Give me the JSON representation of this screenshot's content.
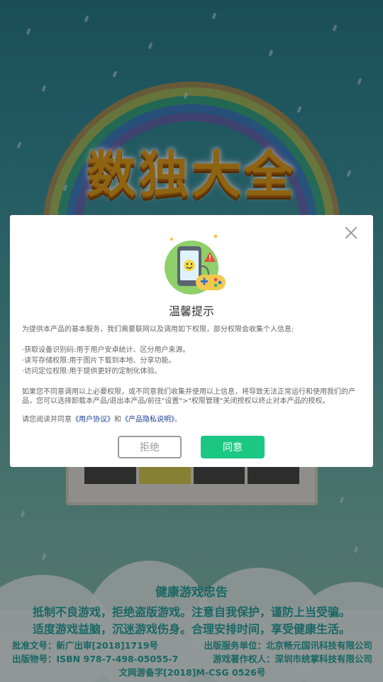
{
  "app": {
    "title": "数独大全"
  },
  "dialog": {
    "title": "温馨提示",
    "intro": "为提供本产品的基本服务，我们需要联网以及调用如下权限，部分权限会收集个人信息:",
    "permissions": [
      "·获取设备识别码:用于用户安卓统计、区分用户来源。",
      "·读写存储权限:用于图片下载到本地、分享功能。",
      "·访问定位权限:用于提供更好的定制化体验。"
    ],
    "disclaimer": "如果您不同意调用以上必要权限，或不同意我们收集并使用以上信息，将导致无法正常运行和使用我们的产品，您可以选择卸载本产品/退出本产品/前往\"设置\">\"权限管理\"关闭授权以终止对本产品的授权。",
    "consent_prefix": "请您阅读并同意",
    "user_agreement_link": "《用户协议》",
    "consent_and": "和",
    "privacy_link": "《产品隐私说明》",
    "consent_suffix": "。",
    "refuse_label": "拒绝",
    "agree_label": "同意",
    "agree_color": "#1cc683"
  },
  "health_notice": {
    "title": "健康游戏忠告",
    "line1": "抵制不良游戏，拒绝盗版游戏。注意自我保护，谨防上当受骗。",
    "line2": "适度游戏益脑，沉迷游戏伤身。合理安排时间，享受健康生活。"
  },
  "publication": {
    "approval": "批准文号：新广出审[2018]1719号",
    "publisher": "出版服务单位：北京畅元国讯科技有限公司",
    "isbn": "出版物号：ISBN 978-7-498-05055-7",
    "copyright_owner": "游戏著作权人：深圳市统掌科技有限公司",
    "filing": "文网游备字[2018]M-CSG 0526号"
  },
  "icons": {
    "close": "close-icon",
    "illustration": "phone-gamepad-icon"
  }
}
